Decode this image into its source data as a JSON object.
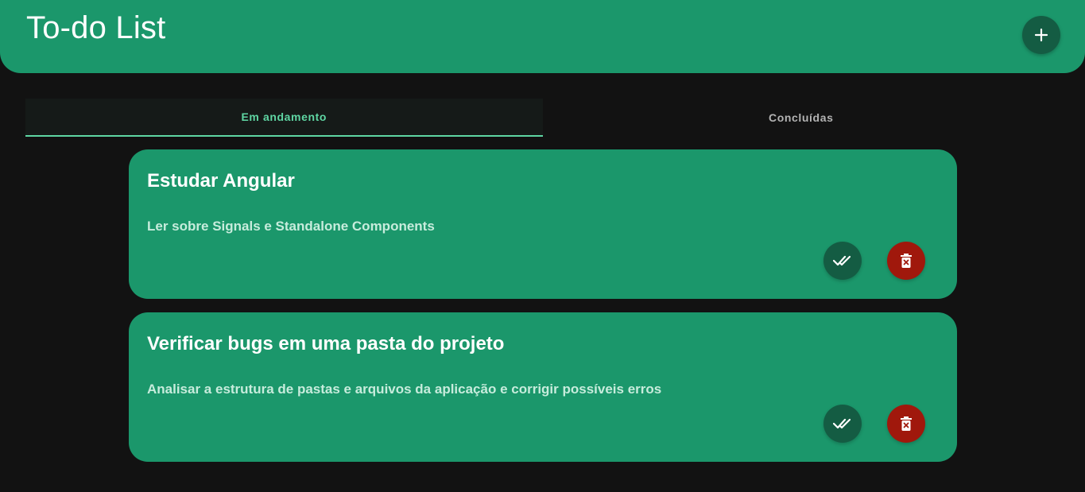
{
  "header": {
    "title": "To-do List",
    "add_icon": "plus-icon"
  },
  "tabs": [
    {
      "label": "Em andamento",
      "active": true
    },
    {
      "label": "Concluídas",
      "active": false
    }
  ],
  "tasks": [
    {
      "title": "Estudar Angular",
      "description": "Ler sobre Signals e Standalone Components",
      "done_icon": "double-check-icon",
      "delete_icon": "trash-icon"
    },
    {
      "title": "Verificar bugs em uma pasta do projeto",
      "description": "Analisar a estrutura de pastas e arquivos da aplicação e corrigir possíveis erros",
      "done_icon": "double-check-icon",
      "delete_icon": "trash-icon"
    }
  ],
  "colors": {
    "background": "#121212",
    "primary": "#1b976b",
    "primary_dark": "#145c43",
    "accent": "#5fd6a3",
    "danger": "#a0180c"
  }
}
